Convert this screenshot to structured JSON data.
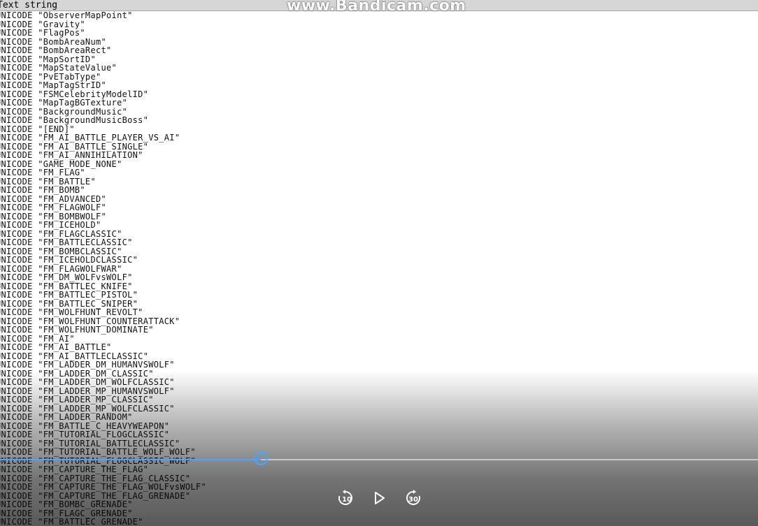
{
  "header": {
    "title": "Text string"
  },
  "watermark": "www.Bandicam.com",
  "rows": [
    "UNICODE \"ObserverMapPoint\"",
    "UNICODE \"Gravity\"",
    "UNICODE \"FlagPos\"",
    "UNICODE \"BombAreaNum\"",
    "UNICODE \"BombAreaRect\"",
    "UNICODE \"MapSortID\"",
    "UNICODE \"MapStateValue\"",
    "UNICODE \"PvETabType\"",
    "UNICODE \"MapTagStrID\"",
    "UNICODE \"FSMCelebrityModelID\"",
    "UNICODE \"MapTagBGTexture\"",
    "UNICODE \"BackgroundMusic\"",
    "UNICODE \"BackgroundMusicBoss\"",
    "UNICODE \"[END]\"",
    "UNICODE \"FM_AI_BATTLE_PLAYER_VS_AI\"",
    "UNICODE \"FM_AI_BATTLE_SINGLE\"",
    "UNICODE \"FM_AI_ANNIHILATION\"",
    "UNICODE \"GAME_MODE_NONE\"",
    "UNICODE \"FM_FLAG\"",
    "UNICODE \"FM_BATTLE\"",
    "UNICODE \"FM_BOMB\"",
    "UNICODE \"FM_ADVANCED\"",
    "UNICODE \"FM_FLAGWOLF\"",
    "UNICODE \"FM_BOMBWOLF\"",
    "UNICODE \"FM_ICEHOLD\"",
    "UNICODE \"FM_FLAGCLASSIC\"",
    "UNICODE \"FM_BATTLECLASSIC\"",
    "UNICODE \"FM_BOMBCLASSIC\"",
    "UNICODE \"FM_ICEHOLDCLASSIC\"",
    "UNICODE \"FM_FLAGWOLFWAR\"",
    "UNICODE \"FM_DM_WOLFvsWOLF\"",
    "UNICODE \"FM_BATTLEC_KNIFE\"",
    "UNICODE \"FM_BATTLEC_PISTOL\"",
    "UNICODE \"FM_BATTLEC_SNIPER\"",
    "UNICODE \"FM_WOLFHUNT_REVOLT\"",
    "UNICODE \"FM_WOLFHUNT_COUNTERATTACK\"",
    "UNICODE \"FM_WOLFHUNT_DOMINATE\"",
    "UNICODE \"FM_AI\"",
    "UNICODE \"FM_AI_BATTLE\"",
    "UNICODE \"FM_AI_BATTLECLASSIC\"",
    "UNICODE \"FM_LADDER_DM_HUMANVSWOLF\"",
    "UNICODE \"FM_LADDER_DM_CLASSIC\"",
    "UNICODE \"FM_LADDER_DM_WOLFCLASSIC\"",
    "UNICODE \"FM_LADDER_MP_HUMANVSWOLF\"",
    "UNICODE \"FM_LADDER_MP_CLASSIC\"",
    "UNICODE \"FM_LADDER_MP_WOLFCLASSIC\"",
    "UNICODE \"FM_LADDER_RANDOM\"",
    "UNICODE \"FM_BATTLE_C_HEAVYWEAPON\"",
    "UNICODE \"FM_TUTORIAL_FLOGCLASSIC\"",
    "UNICODE \"FM_TUTORIAL_BATTLECLASSIC\"",
    "UNICODE \"FM_TUTORIAL_BATTLE_WOLF_WOLF\"",
    "UNICODE \"FM_TUTORIAL_FLOGCLASSIC_WOLF\"",
    "UNICODE \"FM_CAPTURE_THE_FLAG\"",
    "UNICODE \"FM_CAPTURE_THE_FLAG_CLASSIC\"",
    "UNICODE \"FM_CAPTURE_THE_FLAG_WOLFvsWOLF\"",
    "UNICODE \"FM_CAPTURE_THE_FLAG_GRENADE\"",
    "UNICODE \"FM_BOMBC_GRENADE\"",
    "UNICODE \"FM_FLAGC_GRENADE\"",
    "UNICODE \"FM_BATTLEC_GRENADE\""
  ],
  "player": {
    "rewind_label": "10",
    "forward_label": "30",
    "progress": 0.344,
    "accent_color": "#4da3ff"
  },
  "icons": {
    "rewind": "rewind-10-icon",
    "play": "play-icon",
    "forward": "forward-30-icon"
  }
}
